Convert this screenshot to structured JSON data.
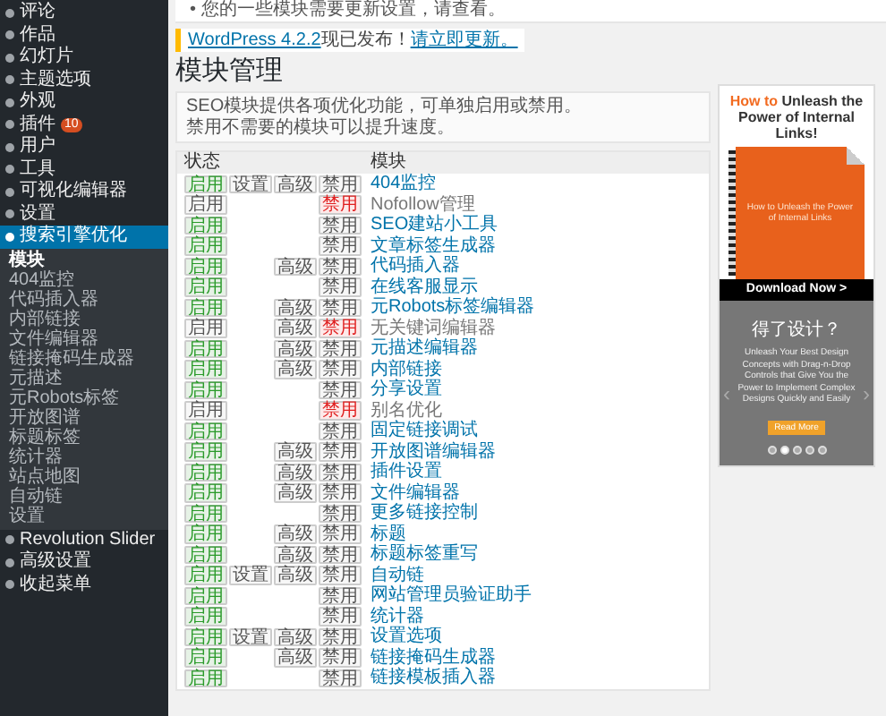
{
  "sidebar": {
    "items": [
      {
        "label": "评论",
        "selected": false
      },
      {
        "label": "作品",
        "selected": false
      },
      {
        "label": "幻灯片",
        "selected": false
      },
      {
        "label": "主题选项",
        "selected": false
      },
      {
        "label": "外观",
        "selected": false
      },
      {
        "label": "插件",
        "selected": false,
        "badge": "10"
      },
      {
        "label": "用户",
        "selected": false
      },
      {
        "label": "工具",
        "selected": false
      },
      {
        "label": "可视化编辑器",
        "selected": false
      },
      {
        "label": "设置",
        "selected": false
      },
      {
        "label": "搜索引擎优化",
        "selected": true,
        "children": [
          {
            "label": "模块",
            "selected": true
          },
          {
            "label": "404监控",
            "selected": false
          },
          {
            "label": "代码插入器",
            "selected": false
          },
          {
            "label": "内部链接",
            "selected": false
          },
          {
            "label": "文件编辑器",
            "selected": false
          },
          {
            "label": "链接掩码生成器",
            "selected": false
          },
          {
            "label": "元描述",
            "selected": false
          },
          {
            "label": "元Robots标签",
            "selected": false
          },
          {
            "label": "开放图谱",
            "selected": false
          },
          {
            "label": "标题标签",
            "selected": false
          },
          {
            "label": "统计器",
            "selected": false
          },
          {
            "label": "站点地图",
            "selected": false
          },
          {
            "label": "自动链",
            "selected": false
          },
          {
            "label": "设置",
            "selected": false
          }
        ]
      },
      {
        "label": "Revolution Slider",
        "selected": false
      },
      {
        "label": "高级设置",
        "selected": false
      },
      {
        "label": "收起菜单",
        "selected": false
      }
    ]
  },
  "top_notice": "• 您的一些模块需要更新设置，请查看。",
  "update_notice": {
    "link": "WordPress 4.2.2",
    "text": "现已发布！",
    "action": "请立即更新。"
  },
  "title": "模块管理",
  "description": [
    "SEO模块提供各项优化功能，可单独启用或禁用。",
    "禁用不需要的模块可以提升速度。"
  ],
  "table": {
    "columns": [
      "状态",
      "模块"
    ],
    "rows": [
      {
        "name": "404监控",
        "enabled": true,
        "buttons": [
          {
            "kind": "enable",
            "label": "启用"
          },
          {
            "kind": "settings",
            "label": "设置"
          },
          {
            "kind": "advanced",
            "label": "高级"
          },
          {
            "kind": "disable",
            "label": "禁用"
          }
        ]
      },
      {
        "name": "Nofollow管理",
        "enabled": false,
        "buttons": [
          {
            "kind": "enable",
            "label": "启用"
          },
          {
            "kind": "disable",
            "label": "禁用"
          }
        ]
      },
      {
        "name": "SEO建站小工具",
        "enabled": true,
        "buttons": [
          {
            "kind": "enable",
            "label": "启用"
          },
          {
            "kind": "disable",
            "label": "禁用"
          }
        ]
      },
      {
        "name": "文章标签生成器",
        "enabled": true,
        "buttons": [
          {
            "kind": "enable",
            "label": "启用"
          },
          {
            "kind": "disable",
            "label": "禁用"
          }
        ]
      },
      {
        "name": "代码插入器",
        "enabled": true,
        "buttons": [
          {
            "kind": "enable",
            "label": "启用"
          },
          {
            "kind": "advanced",
            "label": "高级"
          },
          {
            "kind": "disable",
            "label": "禁用"
          }
        ]
      },
      {
        "name": "在线客服显示",
        "enabled": true,
        "buttons": [
          {
            "kind": "enable",
            "label": "启用"
          },
          {
            "kind": "disable",
            "label": "禁用"
          }
        ]
      },
      {
        "name": "元Robots标签编辑器",
        "enabled": true,
        "buttons": [
          {
            "kind": "enable",
            "label": "启用"
          },
          {
            "kind": "advanced",
            "label": "高级"
          },
          {
            "kind": "disable",
            "label": "禁用"
          }
        ]
      },
      {
        "name": "无关键词编辑器",
        "enabled": false,
        "buttons": [
          {
            "kind": "enable",
            "label": "启用"
          },
          {
            "kind": "advanced",
            "label": "高级"
          },
          {
            "kind": "disable",
            "label": "禁用"
          }
        ]
      },
      {
        "name": "元描述编辑器",
        "enabled": true,
        "buttons": [
          {
            "kind": "enable",
            "label": "启用"
          },
          {
            "kind": "advanced",
            "label": "高级"
          },
          {
            "kind": "disable",
            "label": "禁用"
          }
        ]
      },
      {
        "name": "内部链接",
        "enabled": true,
        "buttons": [
          {
            "kind": "enable",
            "label": "启用"
          },
          {
            "kind": "advanced",
            "label": "高级"
          },
          {
            "kind": "disable",
            "label": "禁用"
          }
        ]
      },
      {
        "name": "分享设置",
        "enabled": true,
        "buttons": [
          {
            "kind": "enable",
            "label": "启用"
          },
          {
            "kind": "disable",
            "label": "禁用"
          }
        ]
      },
      {
        "name": "别名优化",
        "enabled": false,
        "buttons": [
          {
            "kind": "enable",
            "label": "启用"
          },
          {
            "kind": "disable",
            "label": "禁用"
          }
        ]
      },
      {
        "name": "固定链接调试",
        "enabled": true,
        "buttons": [
          {
            "kind": "enable",
            "label": "启用"
          },
          {
            "kind": "disable",
            "label": "禁用"
          }
        ]
      },
      {
        "name": "开放图谱编辑器",
        "enabled": true,
        "buttons": [
          {
            "kind": "enable",
            "label": "启用"
          },
          {
            "kind": "advanced",
            "label": "高级"
          },
          {
            "kind": "disable",
            "label": "禁用"
          }
        ]
      },
      {
        "name": "插件设置",
        "enabled": true,
        "buttons": [
          {
            "kind": "enable",
            "label": "启用"
          },
          {
            "kind": "advanced",
            "label": "高级"
          },
          {
            "kind": "disable",
            "label": "禁用"
          }
        ]
      },
      {
        "name": "文件编辑器",
        "enabled": true,
        "buttons": [
          {
            "kind": "enable",
            "label": "启用"
          },
          {
            "kind": "advanced",
            "label": "高级"
          },
          {
            "kind": "disable",
            "label": "禁用"
          }
        ]
      },
      {
        "name": "更多链接控制",
        "enabled": true,
        "buttons": [
          {
            "kind": "enable",
            "label": "启用"
          },
          {
            "kind": "disable",
            "label": "禁用"
          }
        ]
      },
      {
        "name": "标题",
        "enabled": true,
        "buttons": [
          {
            "kind": "enable",
            "label": "启用"
          },
          {
            "kind": "advanced",
            "label": "高级"
          },
          {
            "kind": "disable",
            "label": "禁用"
          }
        ]
      },
      {
        "name": "标题标签重写",
        "enabled": true,
        "buttons": [
          {
            "kind": "enable",
            "label": "启用"
          },
          {
            "kind": "advanced",
            "label": "高级"
          },
          {
            "kind": "disable",
            "label": "禁用"
          }
        ]
      },
      {
        "name": "自动链",
        "enabled": true,
        "buttons": [
          {
            "kind": "enable",
            "label": "启用"
          },
          {
            "kind": "settings",
            "label": "设置"
          },
          {
            "kind": "advanced",
            "label": "高级"
          },
          {
            "kind": "disable",
            "label": "禁用"
          }
        ]
      },
      {
        "name": "网站管理员验证助手",
        "enabled": true,
        "buttons": [
          {
            "kind": "enable",
            "label": "启用"
          },
          {
            "kind": "disable",
            "label": "禁用"
          }
        ]
      },
      {
        "name": "统计器",
        "enabled": true,
        "buttons": [
          {
            "kind": "enable",
            "label": "启用"
          },
          {
            "kind": "disable",
            "label": "禁用"
          }
        ]
      },
      {
        "name": "设置选项",
        "enabled": true,
        "buttons": [
          {
            "kind": "enable",
            "label": "启用"
          },
          {
            "kind": "settings",
            "label": "设置"
          },
          {
            "kind": "advanced",
            "label": "高级"
          },
          {
            "kind": "disable",
            "label": "禁用"
          }
        ]
      },
      {
        "name": "链接掩码生成器",
        "enabled": true,
        "buttons": [
          {
            "kind": "enable",
            "label": "启用"
          },
          {
            "kind": "advanced",
            "label": "高级"
          },
          {
            "kind": "disable",
            "label": "禁用"
          }
        ]
      },
      {
        "name": "链接模板插入器",
        "enabled": true,
        "buttons": [
          {
            "kind": "enable",
            "label": "启用"
          },
          {
            "kind": "disable",
            "label": "禁用"
          }
        ]
      }
    ]
  },
  "ad": {
    "headline_accent": "How to",
    "headline": "Unleash the Power of Internal Links!",
    "book_title": "How to Unleash the Power of Internal Links",
    "download": "Download Now >",
    "slide_title": "得了设计？",
    "slide_text": "Unleash Your Best Design Concepts with Drag-n-Drop Controls that Give You the Power to Implement Complex Designs Quickly and Easily",
    "slide_button": "Read More",
    "prev": "‹",
    "next": "›",
    "dots": [
      {
        "selected": false
      },
      {
        "selected": true
      },
      {
        "selected": false
      },
      {
        "selected": false
      },
      {
        "selected": false
      }
    ]
  }
}
